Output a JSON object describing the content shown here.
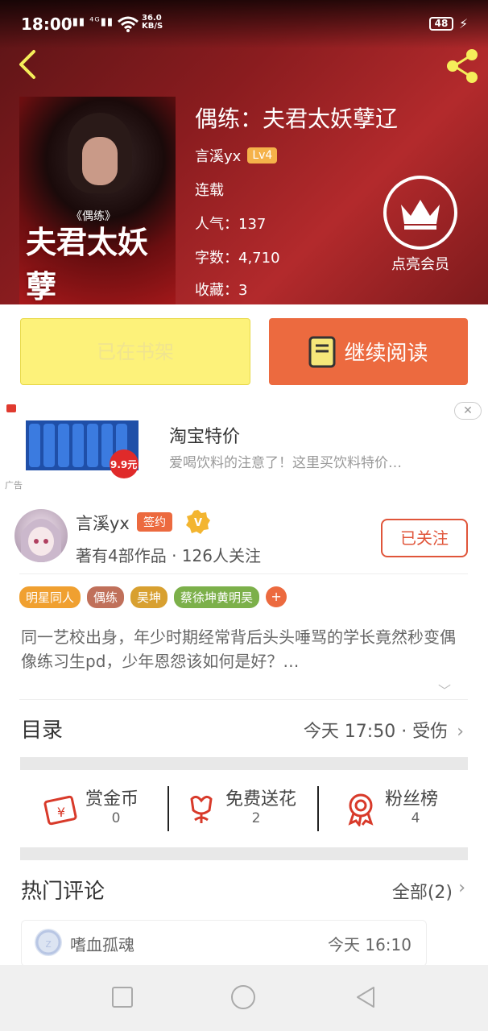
{
  "status_bar": {
    "time": "18:00",
    "signal": "ᵡ▮▮ ⁴ᴳ▮▮",
    "net_speed": "36.0",
    "net_unit": "KB/S",
    "battery": "48"
  },
  "book": {
    "title": "偶练：夫君太妖孽辽",
    "author": "言溪yx",
    "level": "Lv4",
    "status": "连载",
    "popularity_label": "人气：",
    "popularity": "137",
    "words_label": "字数：",
    "words": "4,710",
    "favorites_label": "收藏：",
    "favorites": "3",
    "cover_title": "夫君太妖孽",
    "cover_subtitle": "《偶练》"
  },
  "vip": {
    "label": "点亮会员"
  },
  "actions": {
    "shelf_label": "已在书架",
    "read_label": "继续阅读"
  },
  "ad": {
    "title": "淘宝特价",
    "description": "爱喝饮料的注意了！这里买饮料特价…",
    "tag": "广告",
    "close": "✕",
    "price": "9.9元"
  },
  "author_card": {
    "name": "言溪yx",
    "sign_badge": "签约",
    "v_badge": "V",
    "stats": "著有4部作品 · 126人关注",
    "follow_label": "已关注"
  },
  "tags": [
    {
      "label": "明星同人",
      "color": "#f0a030"
    },
    {
      "label": "偶练",
      "color": "#c0705a"
    },
    {
      "label": "昊坤",
      "color": "#d8a030"
    },
    {
      "label": "蔡徐坤黄明昊",
      "color": "#7cb04a"
    }
  ],
  "tag_more": "+",
  "description": "同一艺校出身，年少时期经常背后头头唾骂的学长竟然秒变偶像练习生pd，少年恩怨该如何是好？…",
  "toc": {
    "label": "目录",
    "latest": "今天 17:50 · 受伤"
  },
  "stats": [
    {
      "name": "赏金币",
      "value": "0",
      "icon": "gift-coin-icon"
    },
    {
      "name": "免费送花",
      "value": "2",
      "icon": "flower-icon"
    },
    {
      "name": "粉丝榜",
      "value": "4",
      "icon": "medal-icon"
    }
  ],
  "hot_comments": {
    "label": "热门评论",
    "all_label": "全部(2)"
  },
  "comment": {
    "name": "嗜血孤魂",
    "time": "今天 16:10"
  },
  "colors": {
    "accent": "#ec6a3f",
    "shelf": "#fdf27a",
    "hero": "#8a1c1f"
  }
}
